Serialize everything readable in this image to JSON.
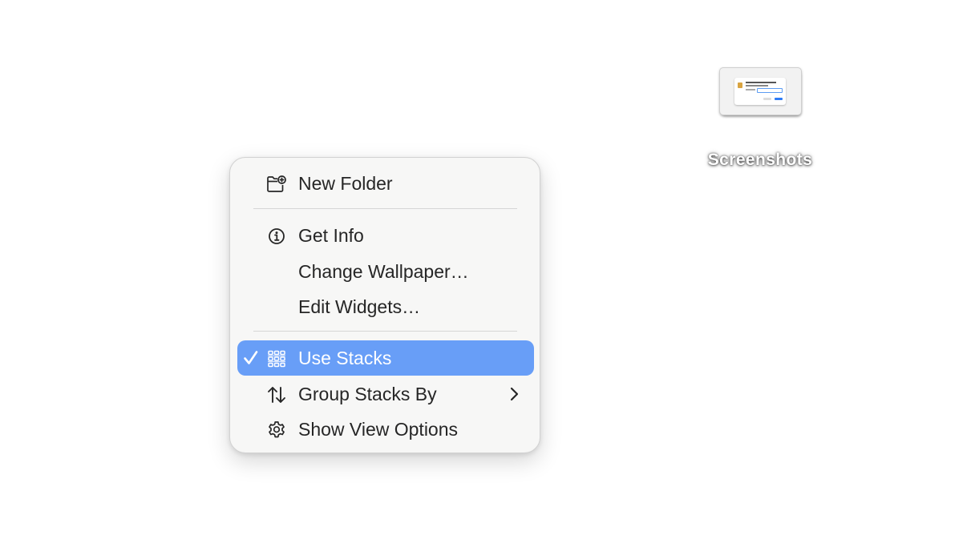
{
  "desktop": {
    "stack": {
      "label": "Screenshots",
      "icon": "screenshot-stack-icon"
    }
  },
  "context_menu": {
    "items": [
      {
        "label": "New Folder",
        "icon": "new-folder-icon",
        "checked": false,
        "selected": false
      },
      {
        "label": "Get Info",
        "icon": "info-icon",
        "checked": false,
        "selected": false
      },
      {
        "label": "Change Wallpaper…",
        "icon": null,
        "checked": false,
        "selected": false
      },
      {
        "label": "Edit Widgets…",
        "icon": null,
        "checked": false,
        "selected": false
      },
      {
        "label": "Use Stacks",
        "icon": "stacks-grid-icon",
        "checked": true,
        "selected": true
      },
      {
        "label": "Group Stacks By",
        "icon": "sort-arrows-icon",
        "checked": false,
        "selected": false,
        "submenu": true
      },
      {
        "label": "Show View Options",
        "icon": "gear-icon",
        "checked": false,
        "selected": false
      }
    ]
  },
  "colors": {
    "highlight": "#689ef7",
    "menu_background": "#f7f7f6",
    "text": "#262626"
  }
}
